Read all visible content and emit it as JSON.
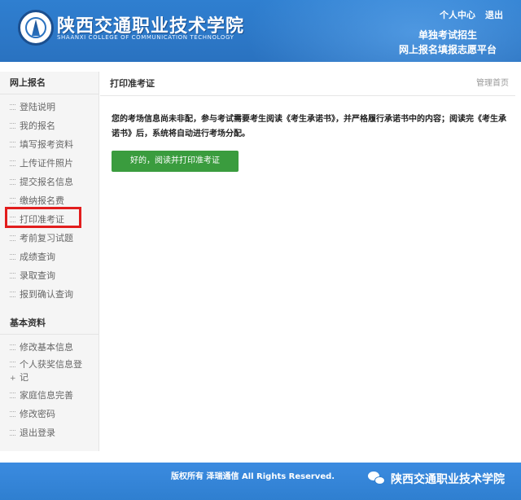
{
  "header": {
    "school_name": "陕西交通职业技术学院",
    "school_name_en": "SHAANXI COLLEGE OF COMMUNICATION TECHNOLOGY",
    "links": [
      "个人中心",
      "退出"
    ],
    "platform_line1": "单独考试招生",
    "platform_line2": "网上报名填报志愿平台"
  },
  "sidebar": {
    "section1_title": "网上报名",
    "section1_items": [
      "登陆说明",
      "我的报名",
      "填写报考资料",
      "上传证件照片",
      "提交报名信息",
      "缴纳报名费",
      "打印准考证",
      "考前复习试题",
      "成绩查询",
      "录取查询",
      "报到确认查询"
    ],
    "section2_title": "基本资料",
    "section2_items": [
      "修改基本信息",
      "个人获奖信息登记",
      "家庭信息完善",
      "修改密码",
      "退出登录"
    ],
    "highlighted_item": "打印准考证"
  },
  "main": {
    "title": "打印准考证",
    "home_link": "管理首页",
    "notice": "您的考场信息尚未非配，参与考试需要考生阅读《考生承诺书》，并严格履行承诺书中的内容；阅读完《考生承诺书》后，系统将自动进行考场分配。",
    "button_label": "好的，阅读并打印准考证"
  },
  "footer": {
    "copyright": "版权所有 泽瑞通信 All Rights Reserved.",
    "watermark": "陕西交通职业技术学院"
  },
  "colors": {
    "header_blue": "#2a72c0",
    "button_green": "#3a9c3e",
    "highlight_red": "#e21d1d"
  }
}
